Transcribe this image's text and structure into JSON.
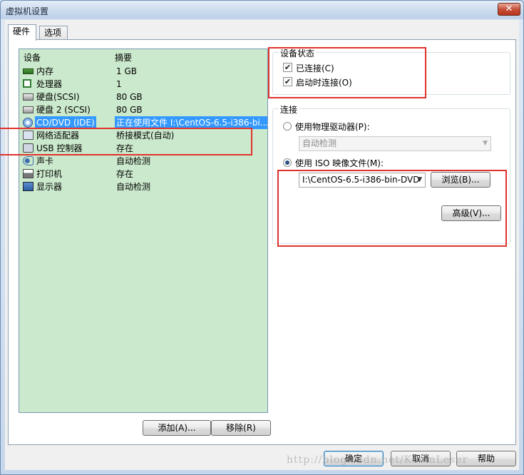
{
  "window": {
    "title": "虚拟机设置",
    "close_label": "✕"
  },
  "tabs": [
    {
      "label": "硬件",
      "active": true
    },
    {
      "label": "选项",
      "active": false
    }
  ],
  "device_list": {
    "columns": {
      "device": "设备",
      "summary": "摘要"
    },
    "rows": [
      {
        "device": "内存",
        "summary": "1 GB",
        "icon": "memory-icon"
      },
      {
        "device": "处理器",
        "summary": "1",
        "icon": "cpu-icon"
      },
      {
        "device": "硬盘(SCSI)",
        "summary": "80 GB",
        "icon": "hard-disk-icon"
      },
      {
        "device": "硬盘 2 (SCSI)",
        "summary": "80 GB",
        "icon": "hard-disk-icon"
      },
      {
        "device": "CD/DVD (IDE)",
        "summary": "正在使用文件 I:\\CentOS-6.5-i386-bi...",
        "icon": "cd-dvd-icon",
        "selected": true
      },
      {
        "device": "网络适配器",
        "summary": "桥接模式(自动)",
        "icon": "network-icon"
      },
      {
        "device": "USB 控制器",
        "summary": "存在",
        "icon": "usb-icon"
      },
      {
        "device": "声卡",
        "summary": "自动检测",
        "icon": "sound-icon"
      },
      {
        "device": "打印机",
        "summary": "存在",
        "icon": "printer-icon"
      },
      {
        "device": "显示器",
        "summary": "自动检测",
        "icon": "display-icon"
      }
    ]
  },
  "buttons": {
    "add": "添加(A)...",
    "remove": "移除(R)",
    "ok": "确定",
    "cancel": "取消",
    "help": "帮助",
    "browse": "浏览(B)...",
    "advanced": "高级(V)..."
  },
  "device_status": {
    "label": "设备状态",
    "connected": {
      "label": "已连接(C)",
      "checked": true
    },
    "connect_at_power_on": {
      "label": "启动时连接(O)",
      "checked": true
    }
  },
  "connection": {
    "label": "连接",
    "physical_drive": {
      "label": "使用物理驱动器(P):",
      "selected": false,
      "value": "自动检测"
    },
    "iso_image": {
      "label": "使用 ISO 映像文件(M):",
      "selected": true,
      "value": "I:\\CentOS-6.5-i386-bin-DVD"
    }
  },
  "watermark": "http://blog.csdn.net/KevinLeser",
  "colors": {
    "device_list_bg": "#cbe9cc",
    "selection": "#3399ff",
    "annotation_red": "#e0322d"
  }
}
